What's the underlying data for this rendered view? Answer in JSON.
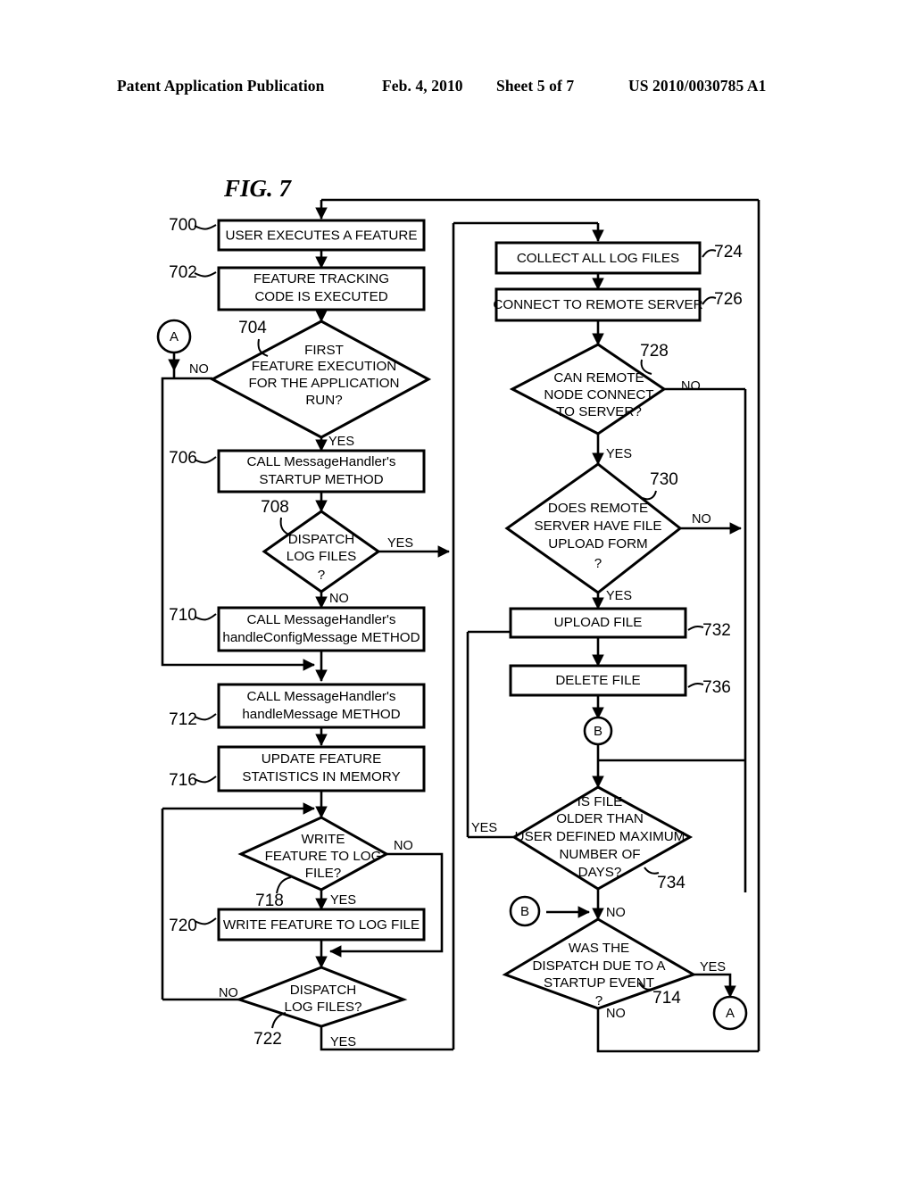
{
  "header": {
    "publication": "Patent Application Publication",
    "date": "Feb. 4, 2010",
    "sheet": "Sheet 5 of 7",
    "number": "US 2010/0030785 A1"
  },
  "figure": {
    "label": "FIG. 7"
  },
  "connectors": {
    "a_top": "A",
    "a_bottom": "A",
    "b_top": "B",
    "b_bottom": "B"
  },
  "nodes": {
    "n700": {
      "ref": "700",
      "lines": [
        "USER EXECUTES A FEATURE"
      ],
      "shape": "process"
    },
    "n702": {
      "ref": "702",
      "lines": [
        "FEATURE TRACKING",
        "CODE IS EXECUTED"
      ],
      "shape": "process"
    },
    "n704": {
      "ref": "704",
      "lines": [
        "FIRST",
        "FEATURE EXECUTION",
        "FOR THE APPLICATION",
        "RUN?"
      ],
      "shape": "decision"
    },
    "n706": {
      "ref": "706",
      "lines": [
        "CALL MessageHandler's",
        "STARTUP METHOD"
      ],
      "shape": "process"
    },
    "n708": {
      "ref": "708",
      "lines": [
        "DISPATCH",
        "LOG FILES",
        "?"
      ],
      "shape": "decision"
    },
    "n710": {
      "ref": "710",
      "lines": [
        "CALL MessageHandler's",
        "handleConfigMessage METHOD"
      ],
      "shape": "process"
    },
    "n712": {
      "ref": "712",
      "lines": [
        "CALL MessageHandler's",
        "handleMessage  METHOD"
      ],
      "shape": "process"
    },
    "n716": {
      "ref": "716",
      "lines": [
        "UPDATE FEATURE",
        "STATISTICS IN MEMORY"
      ],
      "shape": "process"
    },
    "n718": {
      "ref": "718",
      "lines": [
        "WRITE",
        "FEATURE TO LOG",
        "FILE?"
      ],
      "shape": "decision"
    },
    "n720": {
      "ref": "720",
      "lines": [
        "WRITE FEATURE TO LOG FILE"
      ],
      "shape": "process"
    },
    "n722": {
      "ref": "722",
      "lines": [
        "DISPATCH",
        "LOG FILES?"
      ],
      "shape": "decision"
    },
    "n724": {
      "ref": "724",
      "lines": [
        "COLLECT ALL LOG FILES"
      ],
      "shape": "process"
    },
    "n726": {
      "ref": "726",
      "lines": [
        "CONNECT TO REMOTE SERVER"
      ],
      "shape": "process"
    },
    "n728": {
      "ref": "728",
      "lines": [
        "CAN REMOTE",
        "NODE CONNECT",
        "TO SERVER?"
      ],
      "shape": "decision"
    },
    "n730": {
      "ref": "730",
      "lines": [
        "DOES REMOTE",
        "SERVER HAVE FILE",
        "UPLOAD FORM",
        "?"
      ],
      "shape": "decision"
    },
    "n732": {
      "ref": "732",
      "lines": [
        "UPLOAD FILE"
      ],
      "shape": "process"
    },
    "n736": {
      "ref": "736",
      "lines": [
        "DELETE FILE"
      ],
      "shape": "process"
    },
    "n734": {
      "ref": "734",
      "lines": [
        "IS FILE",
        "OLDER THAN",
        "USER DEFINED MAXIMUM",
        "NUMBER OF",
        "DAYS?"
      ],
      "shape": "decision"
    },
    "n714": {
      "ref": "714",
      "lines": [
        "WAS THE",
        "DISPATCH DUE TO A",
        "STARTUP EVENT",
        "?"
      ],
      "shape": "decision"
    }
  },
  "edge_labels": {
    "e704_no": "NO",
    "e704_yes": "YES",
    "e708_yes": "YES",
    "e708_no": "NO",
    "e718_no": "NO",
    "e718_yes": "YES",
    "e722_no": "NO",
    "e722_yes": "YES",
    "e728_no": "NO",
    "e728_yes": "YES",
    "e730_no": "NO",
    "e730_yes": "YES",
    "e734_yes": "YES",
    "e734_no": "NO",
    "e714_yes": "YES",
    "e714_no": "NO"
  },
  "colors": {
    "ink": "#000000",
    "paper": "#ffffff"
  }
}
